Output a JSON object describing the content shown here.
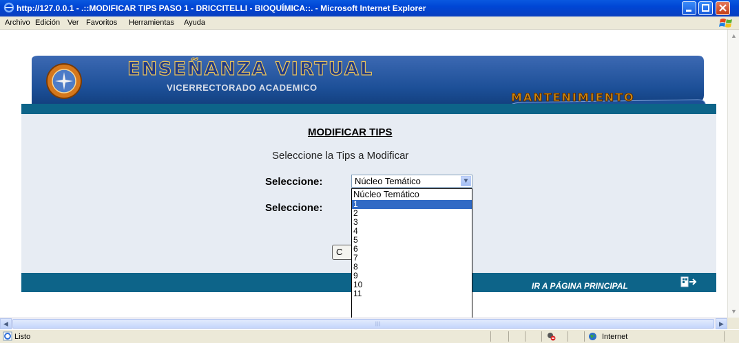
{
  "window": {
    "title": "http://127.0.0.1 - .::MODIFICAR TIPS PASO 1 - DRICCITELLI - BIOQUÍMICA::. - Microsoft Internet Explorer"
  },
  "menu": [
    "Archivo",
    "Edición",
    "Ver",
    "Favoritos",
    "Herramientas",
    "Ayuda"
  ],
  "banner": {
    "title": "ENSEÑANZA VIRTUAL",
    "subtitle": "VICERRECTORADO ACADEMICO",
    "section": "MANTENIMIENTO"
  },
  "form": {
    "heading": "MODIFICAR TIPS",
    "instruction": "Seleccione la Tips a Modificar",
    "select1_label": "Seleccione:",
    "select2_label": "Seleccione:",
    "select1_value": "Núcleo Temático",
    "button_partial": "C"
  },
  "dropdown": {
    "options": [
      "Núcleo Temático",
      "1",
      "2",
      "3",
      "4",
      "5",
      "6",
      "7",
      "8",
      "9",
      "10",
      "11"
    ],
    "highlighted_index": 1
  },
  "footer_link": "IR A PÁGINA PRINCIPAL",
  "status": {
    "text": "Listo",
    "zone": "Internet"
  },
  "colors": {
    "titlebar": "#0046d5",
    "blue_bar": "#0d6489",
    "panel": "#e7ecf3",
    "highlight": "#316ac5"
  }
}
